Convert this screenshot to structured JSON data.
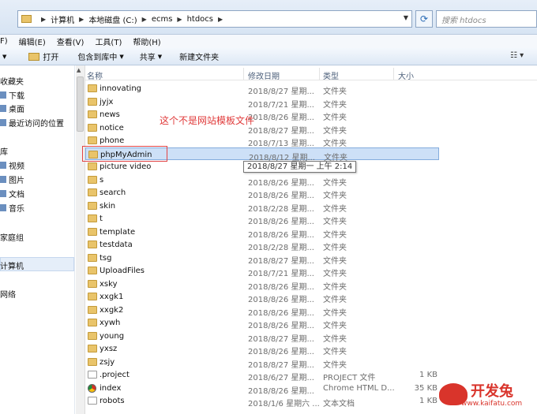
{
  "address": {
    "crumbs": [
      "计算机",
      "本地磁盘 (C:)",
      "ecms",
      "htdocs"
    ],
    "search_placeholder": "搜索 htdocs"
  },
  "menu": [
    "F)",
    "编辑(E)",
    "查看(V)",
    "工具(T)",
    "帮助(H)"
  ],
  "toolbar": {
    "open": "打开",
    "include_library": "包含到库中",
    "share": "共享",
    "new_folder": "新建文件夹"
  },
  "nav": {
    "favorites": "收藏夹",
    "downloads": "下载",
    "desktop": "桌面",
    "recent": "最近访问的位置",
    "libraries": "库",
    "videos": "视频",
    "pictures": "图片",
    "documents": "文档",
    "music": "音乐",
    "homegroup": "家庭组",
    "computer": "计算机",
    "network": "网络"
  },
  "columns": {
    "name": "名称",
    "date": "修改日期",
    "type": "类型",
    "size": "大小"
  },
  "files": [
    {
      "name": "innovating",
      "date": "2018/8/27 星期...",
      "type": "文件夹",
      "size": "",
      "icon": "folder"
    },
    {
      "name": "jyjx",
      "date": "2018/7/21 星期...",
      "type": "文件夹",
      "size": "",
      "icon": "folder"
    },
    {
      "name": "news",
      "date": "2018/8/26 星期...",
      "type": "文件夹",
      "size": "",
      "icon": "folder"
    },
    {
      "name": "notice",
      "date": "2018/8/27 星期...",
      "type": "文件夹",
      "size": "",
      "icon": "folder"
    },
    {
      "name": "phone",
      "date": "2018/7/13 星期...",
      "type": "文件夹",
      "size": "",
      "icon": "folder"
    },
    {
      "name": "phpMyAdmin",
      "date": "2018/8/12 星期...",
      "type": "文件夹",
      "size": "",
      "icon": "folder"
    },
    {
      "name": "picture video",
      "date": "",
      "type": "",
      "size": "",
      "icon": "folder"
    },
    {
      "name": "s",
      "date": "2018/8/26 星期...",
      "type": "文件夹",
      "size": "",
      "icon": "folder"
    },
    {
      "name": "search",
      "date": "2018/8/26 星期...",
      "type": "文件夹",
      "size": "",
      "icon": "folder"
    },
    {
      "name": "skin",
      "date": "2018/2/28 星期...",
      "type": "文件夹",
      "size": "",
      "icon": "folder"
    },
    {
      "name": "t",
      "date": "2018/8/26 星期...",
      "type": "文件夹",
      "size": "",
      "icon": "folder"
    },
    {
      "name": "template",
      "date": "2018/8/26 星期...",
      "type": "文件夹",
      "size": "",
      "icon": "folder"
    },
    {
      "name": "testdata",
      "date": "2018/2/28 星期...",
      "type": "文件夹",
      "size": "",
      "icon": "folder"
    },
    {
      "name": "tsg",
      "date": "2018/8/27 星期...",
      "type": "文件夹",
      "size": "",
      "icon": "folder"
    },
    {
      "name": "UploadFiles",
      "date": "2018/7/21 星期...",
      "type": "文件夹",
      "size": "",
      "icon": "folder"
    },
    {
      "name": "xsky",
      "date": "2018/8/26 星期...",
      "type": "文件夹",
      "size": "",
      "icon": "folder"
    },
    {
      "name": "xxgk1",
      "date": "2018/8/26 星期...",
      "type": "文件夹",
      "size": "",
      "icon": "folder"
    },
    {
      "name": "xxgk2",
      "date": "2018/8/26 星期...",
      "type": "文件夹",
      "size": "",
      "icon": "folder"
    },
    {
      "name": "xywh",
      "date": "2018/8/26 星期...",
      "type": "文件夹",
      "size": "",
      "icon": "folder"
    },
    {
      "name": "young",
      "date": "2018/8/27 星期...",
      "type": "文件夹",
      "size": "",
      "icon": "folder"
    },
    {
      "name": "yxsz",
      "date": "2018/8/26 星期...",
      "type": "文件夹",
      "size": "",
      "icon": "folder"
    },
    {
      "name": "zsjy",
      "date": "2018/8/27 星期...",
      "type": "文件夹",
      "size": "",
      "icon": "folder"
    },
    {
      "name": ".project",
      "date": "2018/6/27 星期...",
      "type": "PROJECT 文件",
      "size": "1 KB",
      "icon": "doc"
    },
    {
      "name": "index",
      "date": "2018/8/26 星期...",
      "type": "Chrome HTML D...",
      "size": "35 KB",
      "icon": "chrome"
    },
    {
      "name": "robots",
      "date": "2018/1/6 星期六 ...",
      "type": "文本文档",
      "size": "1 KB",
      "icon": "doc"
    }
  ],
  "selected_index": 5,
  "tooltip": "2018/8/27 星期一 上午 2:14",
  "annotation": "这个不是网站模板文件",
  "watermark": {
    "main": "开发兔",
    "sub": "www.kaifatu.com"
  }
}
